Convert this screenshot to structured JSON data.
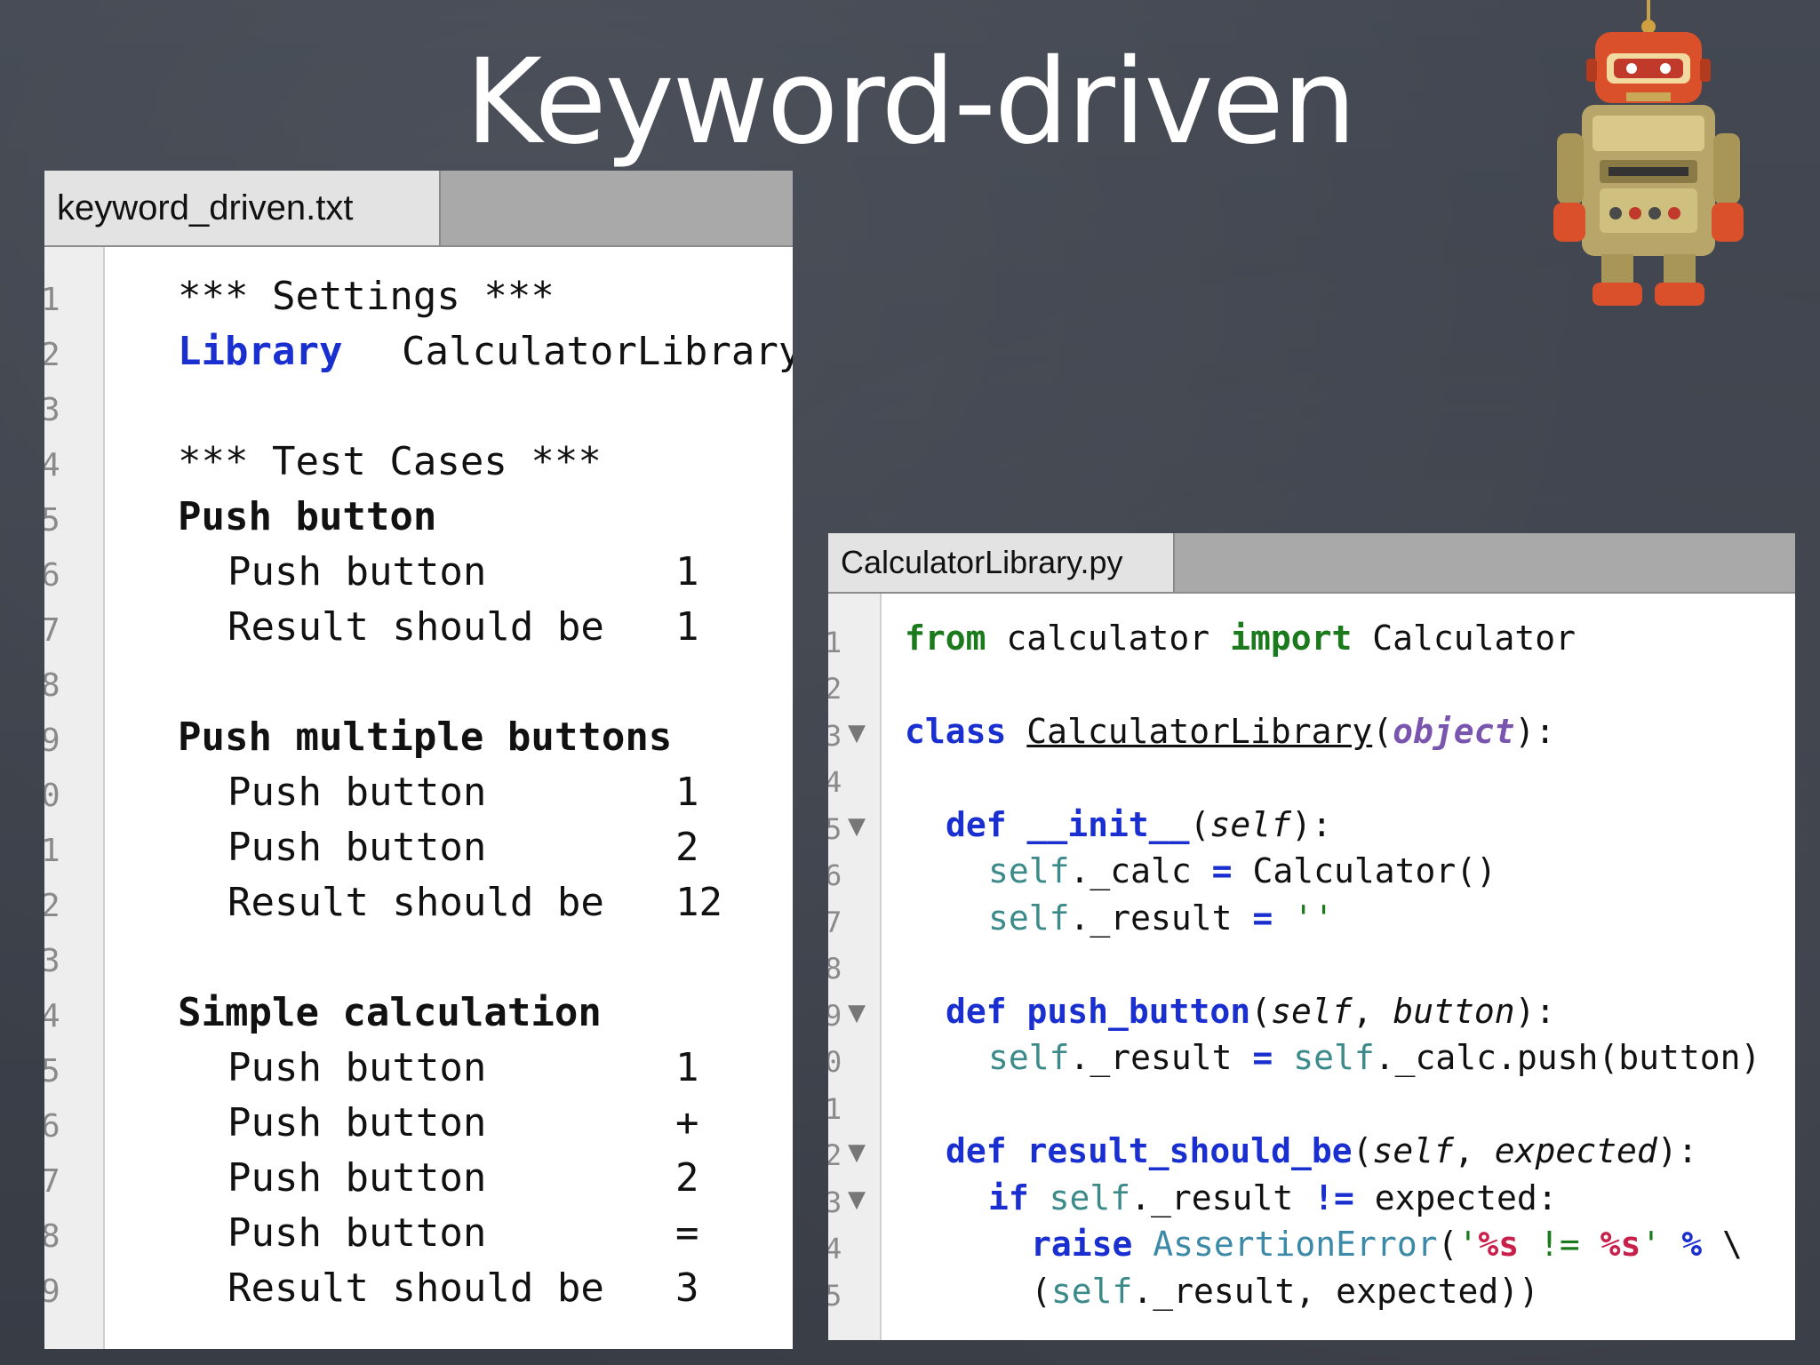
{
  "slide": {
    "title": "Keyword-driven"
  },
  "robot_file": {
    "tab": "keyword_driven.txt",
    "line_numbers": [
      "1",
      "2",
      "3",
      "4",
      "5",
      "6",
      "7",
      "8",
      "9",
      "0",
      "1",
      "2",
      "3",
      "4",
      "5",
      "6",
      "7",
      "8",
      "9"
    ],
    "lines": {
      "l1": "*** Settings ***",
      "l2_kw": "Library",
      "l2_val": "CalculatorLibrary",
      "l4": "*** Test Cases ***",
      "l5": "Push button",
      "l6_kw": "Push button",
      "l6_arg": "1",
      "l7_kw": "Result should be",
      "l7_arg": "1",
      "l9": "Push multiple buttons",
      "l10_kw": "Push button",
      "l10_arg": "1",
      "l11_kw": "Push button",
      "l11_arg": "2",
      "l12_kw": "Result should be",
      "l12_arg": "12",
      "l14": "Simple calculation",
      "l15_kw": "Push button",
      "l15_arg": "1",
      "l16_kw": "Push button",
      "l16_arg": "+",
      "l17_kw": "Push button",
      "l17_arg": "2",
      "l18_kw": "Push button",
      "l18_arg": "=",
      "l19_kw": "Result should be",
      "l19_arg": "3"
    }
  },
  "python_file": {
    "tab": "CalculatorLibrary.py",
    "line_numbers": [
      "1",
      "2",
      "3",
      "4",
      "5",
      "6",
      "7",
      "8",
      "9",
      "0",
      "1",
      "2",
      "3",
      "4",
      "5"
    ],
    "fold_marker": "▼",
    "tokens": {
      "from": "from",
      "calculator": " calculator ",
      "import": "import",
      "Calculator": " Calculator",
      "class": "class",
      "classname": "CalculatorLibrary",
      "paren_open": "(",
      "object": "object",
      "paren_close_colon": "):",
      "def": "def",
      "init": "__init__",
      "self_param": "self",
      "close_colon": "):",
      "self": "self",
      "calc_assign": "._calc ",
      "eq": "=",
      "calc_ctor": " Calculator()",
      "result_attr": "._result ",
      "empty_str": " ''",
      "push_button": "push_button",
      "comma_button": ", ",
      "button": "button",
      "calc_push": "._calc.push(button)",
      "result_should_be": "result_should_be",
      "expected": "expected",
      "if": "if",
      "ne": "!=",
      "expected_colon": " expected:",
      "raise": "raise",
      "AssertionError": "AssertionError",
      "str_open": "'",
      "fmt1": "%s",
      "ne_str": "!=",
      "fmt2": "%s",
      "str_close": "'",
      "percent": "%",
      "backslash": "\\",
      "tuple_open": "(",
      "result_tuple_rest": "._result, expected))"
    }
  }
}
